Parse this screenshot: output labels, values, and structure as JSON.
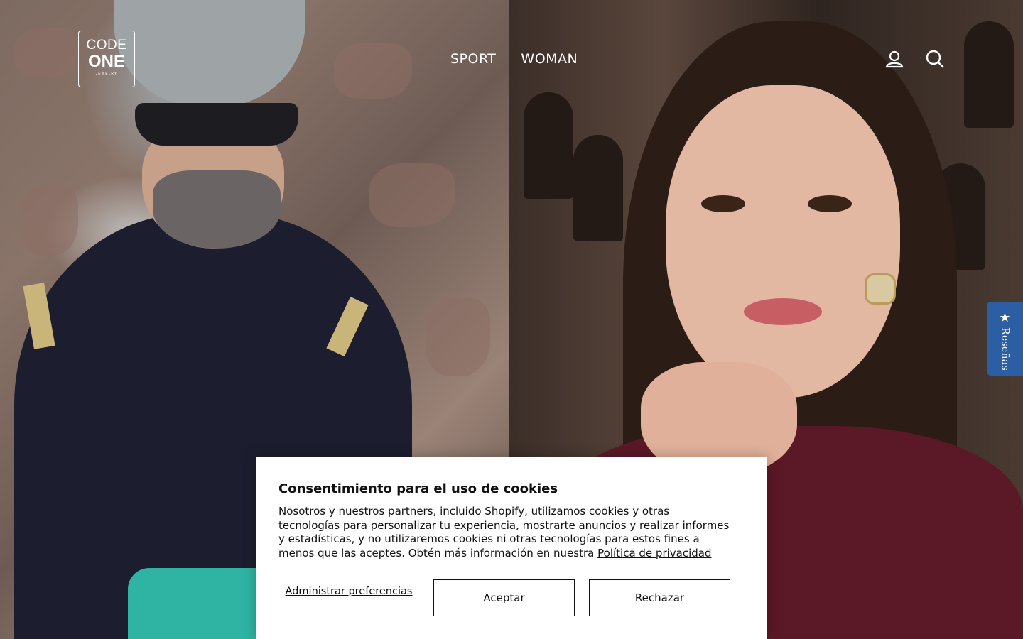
{
  "brand": {
    "logo_line1": "CODE",
    "logo_line2": "ONE",
    "logo_line3": "JEWELRY"
  },
  "nav": {
    "items": [
      {
        "label": "SPORT"
      },
      {
        "label": "WOMAN"
      }
    ]
  },
  "header_icons": {
    "account": "account-icon",
    "search": "search-icon"
  },
  "reviews_tab": {
    "label": "Reseñas",
    "icon": "star-icon"
  },
  "cookie_banner": {
    "title": "Consentimiento para el uso de cookies",
    "body": "Nosotros y nuestros partners, incluido Shopify, utilizamos cookies y otras tecnologías para personalizar tu experiencia, mostrarte anuncios y realizar informes y estadísticas, y no utilizaremos cookies ni otras tecnologías para estos fines a menos que las aceptes. Obtén más información en nuestra",
    "privacy_link": "Política de privacidad",
    "manage_label": "Administrar preferencias",
    "accept_label": "Aceptar",
    "reject_label": "Rechazar"
  },
  "colors": {
    "reviews_tab_bg": "#2c5ea3",
    "banner_bg": "#ffffff",
    "text": "#111111"
  }
}
